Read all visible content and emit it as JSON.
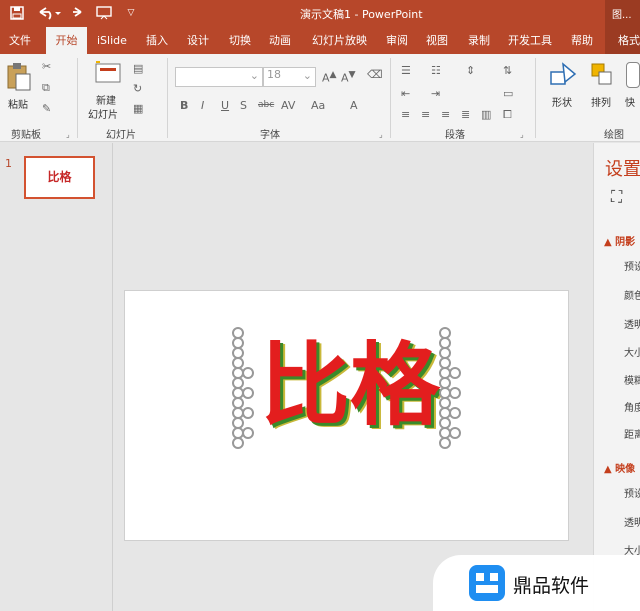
{
  "window": {
    "title": "演示文稿1  -  PowerPoint",
    "right_tab_partial": "图..."
  },
  "quick_access": {
    "save_icon": "save-icon",
    "undo_icon": "undo-icon",
    "redo_icon": "redo-icon",
    "present_icon": "present-from-start-icon",
    "customize_icon": "customize-caret-icon"
  },
  "ribbon_tabs": [
    "文件",
    "开始",
    "iSlide",
    "插入",
    "设计",
    "切换",
    "动画",
    "幻灯片放映",
    "审阅",
    "视图",
    "录制",
    "开发工具",
    "帮助",
    "格式"
  ],
  "active_tab": "开始",
  "ribbon": {
    "clipboard": {
      "paste": "粘贴",
      "label": "剪贴板"
    },
    "slides": {
      "new_slide_line1": "新建",
      "new_slide_line2": "幻灯片",
      "label": "幻灯片"
    },
    "font": {
      "family_value": "",
      "size_value": "18",
      "label": "字体",
      "buttons": [
        "B",
        "I",
        "U",
        "S",
        "abc",
        "AV",
        "Aa",
        "A"
      ]
    },
    "paragraph": {
      "label": "段落"
    },
    "drawing": {
      "shape": "形状",
      "arrange": "排列",
      "quick": "快",
      "label": "绘图"
    }
  },
  "thumbnails": [
    {
      "number": "1",
      "text": "比格"
    }
  ],
  "slide": {
    "text": "比格"
  },
  "format_pane": {
    "title": "设置",
    "section1": "阴影",
    "section1_items": [
      "预设",
      "颜色",
      "透明",
      "大小",
      "模糊",
      "角度",
      "距离"
    ],
    "section2": "映像",
    "section2_items": [
      "预设",
      "透明",
      "大小"
    ]
  },
  "watermark": {
    "text": "鼎品软件"
  },
  "colors": {
    "accent": "#b7472a",
    "slide_text": "#e31e1e",
    "shadow_green": "#3a8a2a"
  }
}
